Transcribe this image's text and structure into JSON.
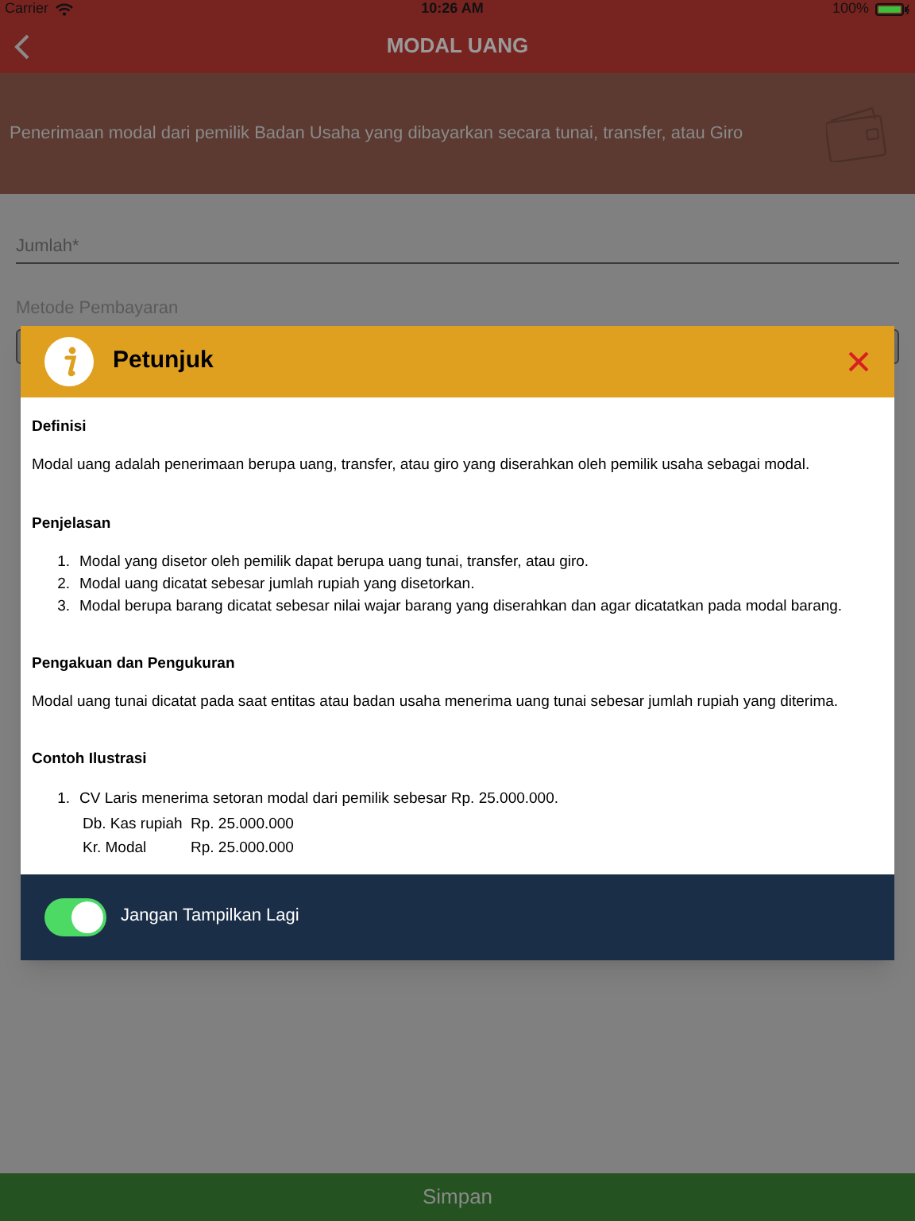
{
  "status_bar": {
    "carrier": "Carrier",
    "time": "10:26 AM",
    "battery": "100%"
  },
  "nav": {
    "title": "MODAL UANG"
  },
  "banner": {
    "text": "Penerimaan modal dari pemilik Badan Usaha yang dibayarkan secara tunai, transfer, atau Giro"
  },
  "form": {
    "amount": {
      "placeholder": "Jumlah*"
    },
    "payment_label": "Metode Pembayaran"
  },
  "dialog": {
    "title": "Petunjuk",
    "sections": [
      {
        "kind": "paragraph",
        "heading": "Definisi",
        "text": "Modal uang adalah penerimaan berupa uang, transfer, atau giro yang diserahkan oleh pemilik usaha sebagai modal."
      },
      {
        "kind": "list",
        "heading": "Penjelasan",
        "items": [
          {
            "number": "1.",
            "text": "Modal yang disetor oleh pemilik dapat berupa uang tunai, transfer, atau giro."
          },
          {
            "number": "2.",
            "text": "Modal uang dicatat sebesar jumlah rupiah yang disetorkan."
          },
          {
            "number": "3.",
            "text": "Modal berupa barang dicatat sebesar nilai wajar barang yang diserahkan dan agar dicatatkan pada modal barang."
          }
        ]
      },
      {
        "kind": "paragraph",
        "heading": "Pengakuan dan Pengukuran",
        "text": "Modal uang tunai dicatat pada saat entitas atau badan usaha menerima uang tunai sebesar jumlah rupiah yang diterima."
      },
      {
        "kind": "example",
        "heading": "Contoh Ilustrasi",
        "items": [
          {
            "number": "1.",
            "text": "CV Laris menerima setoran modal dari pemilik sebesar Rp. 25.000.000.",
            "entries": [
              {
                "account": "Db. Kas rupiah",
                "amount": "Rp. 25.000.000"
              },
              {
                "account": "Kr. Modal",
                "amount": "Rp. 25.000.000"
              }
            ]
          }
        ]
      }
    ],
    "toggle": {
      "label": "Jangan Tampilkan Lagi",
      "on": true
    }
  },
  "save_button": "Simpan"
}
